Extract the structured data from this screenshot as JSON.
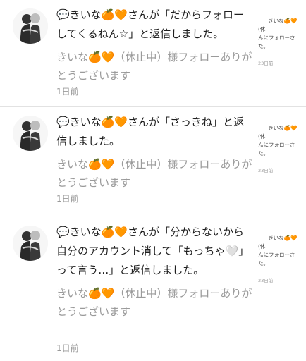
{
  "notifications": [
    {
      "message": "💬きいな🍊🧡さんが「だからフォローしてくるねん☆」と返信しました。",
      "follow_note": "きいな🍊🧡（休止中）様フォローありがとうございます",
      "date": "1日前",
      "thumb_text": "きいな🍊🧡(休\nんにフォローさ\nた。",
      "thumb_time": "23日前"
    },
    {
      "message": "💬きいな🍊🧡さんが「さっきね」と返信しました。",
      "follow_note": "きいな🍊🧡（休止中）様フォローありがとうございます",
      "date": "1日前",
      "thumb_text": "きいな🍊🧡(休\nんにフォローさ\nた。",
      "thumb_time": "23日前"
    },
    {
      "message": "💬きいな🍊🧡さんが「分からないから自分のアカウント消して「もっちゃ🤍」って言う…」と返信しました。",
      "follow_note": "きいな🍊🧡（休止中）様フォローありがとうございます",
      "date": "1日前",
      "thumb_text": "きいな🍊🧡(休\nんにフォローさ\nた。",
      "thumb_time": "23日前"
    }
  ],
  "colors": {
    "primary_text": "#1f1f1f",
    "secondary_text": "#9a9a9a",
    "divider": "#e2e2e2"
  }
}
